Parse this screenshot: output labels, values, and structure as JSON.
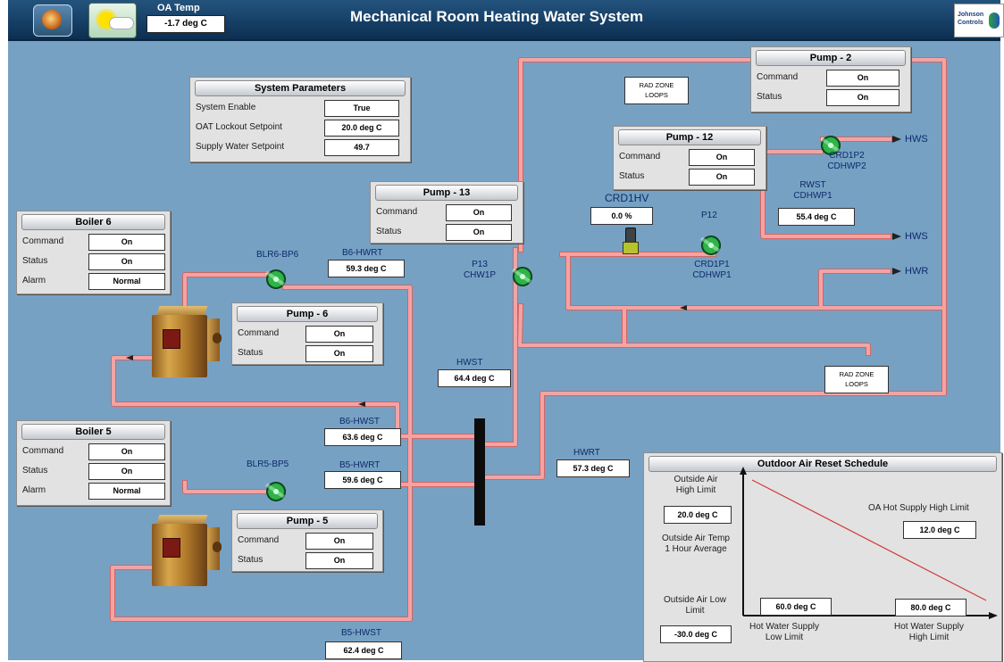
{
  "header": {
    "title": "Mechanical Room Heating Water System",
    "oa_temp_label": "OA Temp",
    "oa_temp_value": "-1.7 deg C",
    "logo_text_1": "Johnson",
    "logo_text_2": "Controls"
  },
  "system_parameters": {
    "title": "System Parameters",
    "rows": [
      {
        "label": "System Enable",
        "value": "True"
      },
      {
        "label": "OAT Lockout Setpoint",
        "value": "20.0 deg C"
      },
      {
        "label": "Supply Water Setpoint",
        "value": "49.7"
      }
    ]
  },
  "pumps": {
    "pump2": {
      "title": "Pump - 2",
      "command_label": "Command",
      "command": "On",
      "status_label": "Status",
      "status": "On"
    },
    "pump12": {
      "title": "Pump - 12",
      "command_label": "Command",
      "command": "On",
      "status_label": "Status",
      "status": "On"
    },
    "pump13": {
      "title": "Pump - 13",
      "command_label": "Command",
      "command": "On",
      "status_label": "Status",
      "status": "On"
    },
    "pump6": {
      "title": "Pump - 6",
      "command_label": "Command",
      "command": "On",
      "status_label": "Status",
      "status": "On"
    },
    "pump5": {
      "title": "Pump - 5",
      "command_label": "Command",
      "command": "On",
      "status_label": "Status",
      "status": "On"
    }
  },
  "boilers": {
    "boiler6": {
      "title": "Boiler 6",
      "command_label": "Command",
      "command": "On",
      "status_label": "Status",
      "status": "On",
      "alarm_label": "Alarm",
      "alarm": "Normal"
    },
    "boiler5": {
      "title": "Boiler 5",
      "command_label": "Command",
      "command": "On",
      "status_label": "Status",
      "status": "On",
      "alarm_label": "Alarm",
      "alarm": "Normal"
    }
  },
  "sensors": {
    "b6_hwrt": {
      "label": "B6-HWRT",
      "value": "59.3 deg C"
    },
    "b6_hwst": {
      "label": "B6-HWST",
      "value": "63.6 deg C"
    },
    "b5_hwrt": {
      "label": "B5-HWRT",
      "value": "59.6 deg C"
    },
    "b5_hwst": {
      "label": "B5-HWST",
      "value": "62.4 deg C"
    },
    "hwst": {
      "label": "HWST",
      "value": "64.4 deg C"
    },
    "hwrt": {
      "label": "HWRT",
      "value": "57.3 deg C"
    },
    "crd1hv": {
      "label": "CRD1HV",
      "value": "0.0 %"
    },
    "rwst": {
      "label_1": "RWST",
      "label_2": "CDHWP1",
      "value": "55.4 deg C"
    }
  },
  "labels": {
    "blr6_bp6": "BLR6-BP6",
    "blr5_bp5": "BLR5-BP5",
    "p13_1": "P13",
    "p13_2": "CHW1P",
    "p12": "P12",
    "crd1p1_1": "CRD1P1",
    "crd1p1_2": "CDHWP1",
    "crd1p2_1": "CRD1P2",
    "crd1p2_2": "CDHWP2",
    "hws_1": "HWS",
    "hws_2": "HWS",
    "hwr": "HWR",
    "rad_zone_1a": "RAD ZONE",
    "rad_zone_1b": "LOOPS",
    "rad_zone_2a": "RAD ZONE",
    "rad_zone_2b": "LOOPS"
  },
  "oa_reset": {
    "title": "Outdoor Air Reset Schedule",
    "oa_high_limit_label_1": "Outside Air",
    "oa_high_limit_label_2": "High Limit",
    "oa_high_limit_value": "20.0 deg C",
    "oa_temp_label_1": "Outside Air Temp",
    "oa_temp_label_2": "1 Hour Average",
    "oa_low_limit_label_1": "Outside Air Low",
    "oa_low_limit_label_2": "Limit",
    "oa_low_limit_value": "-30.0 deg C",
    "hot_supply_high_label": "OA Hot Supply High Limit",
    "hot_supply_high_value": "12.0 deg C",
    "hw_low_limit_value": "60.0 deg C",
    "hw_low_limit_label_1": "Hot Water Supply",
    "hw_low_limit_label_2": "Low Limit",
    "hw_high_limit_value": "80.0 deg C",
    "hw_high_limit_label_1": "Hot Water Supply",
    "hw_high_limit_label_2": "High Limit"
  },
  "colors": {
    "background": "#77a1c3",
    "pipe": "#f4a3a3",
    "pipe_edge": "#cc6767",
    "pump_green": "#2fb34a",
    "panel": "#e2e2e2"
  }
}
